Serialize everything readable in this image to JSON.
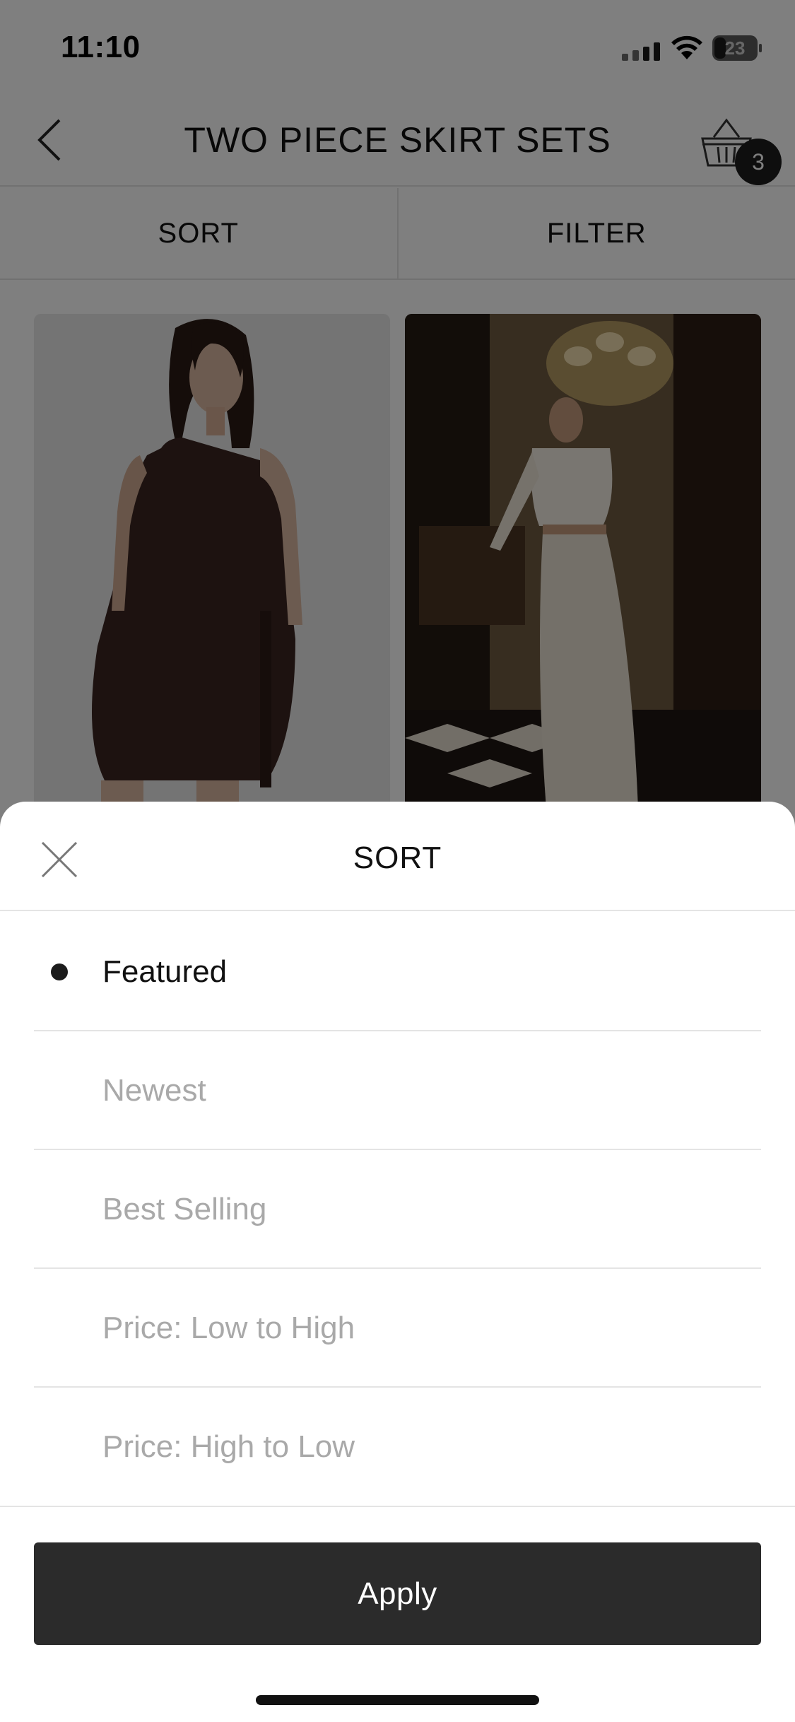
{
  "status_bar": {
    "time": "11:10",
    "battery": "23"
  },
  "header": {
    "title": "TWO PIECE SKIRT SETS",
    "cart_count": "3"
  },
  "toolbar": {
    "sort_label": "SORT",
    "filter_label": "FILTER"
  },
  "products": [
    {
      "icon": "product-photo-brown-one-shoulder-dress"
    },
    {
      "icon": "product-photo-lace-two-piece-set"
    }
  ],
  "sort_sheet": {
    "title": "SORT",
    "options": [
      {
        "label": "Featured",
        "selected": true
      },
      {
        "label": "Newest",
        "selected": false
      },
      {
        "label": "Best Selling",
        "selected": false
      },
      {
        "label": "Price: Low to High",
        "selected": false
      },
      {
        "label": "Price: High to Low",
        "selected": false
      }
    ],
    "apply_label": "Apply"
  },
  "colors": {
    "primary": "#2b2b2b",
    "inactive_text": "#a9a9a9",
    "divider": "#e4e4e4"
  }
}
